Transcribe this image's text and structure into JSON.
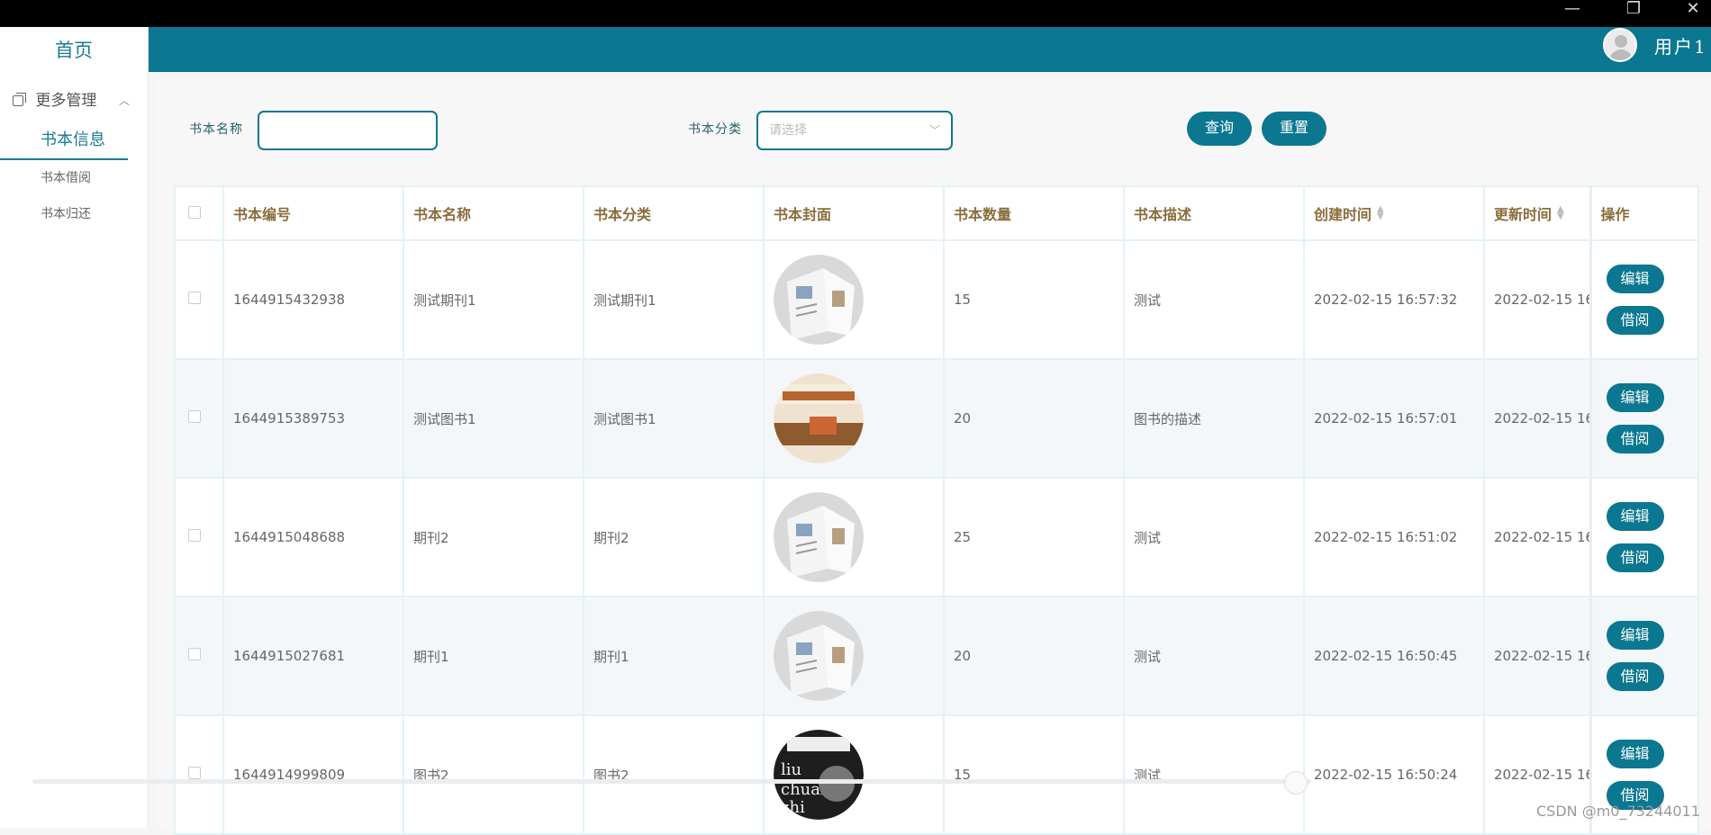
{
  "window": {
    "minimize_glyph": "—",
    "maximize_glyph": "❐",
    "close_glyph": "✕"
  },
  "sidebar": {
    "home": "首页",
    "group_label": "更多管理",
    "group_icon": "copy-icon",
    "items": [
      {
        "label": "书本信息",
        "active": true
      },
      {
        "label": "书本借阅",
        "active": false
      },
      {
        "label": "书本归还",
        "active": false
      }
    ]
  },
  "header": {
    "username": "用户1",
    "avatar_icon": "user-avatar-icon"
  },
  "search": {
    "name_label": "书本名称",
    "name_value": "",
    "category_label": "书本分类",
    "category_placeholder": "请选择",
    "query_button": "查询",
    "reset_button": "重置"
  },
  "table": {
    "columns": [
      "书本编号",
      "书本名称",
      "书本分类",
      "书本封面",
      "书本数量",
      "书本描述",
      "创建时间",
      "更新时间",
      "操作"
    ],
    "sortable_columns": [
      "创建时间",
      "更新时间"
    ],
    "rows": [
      {
        "id": "1644915432938",
        "name": "测试期刊1",
        "category": "测试期刊1",
        "cover": "magazine-cover",
        "quantity": "15",
        "desc": "测试",
        "created": "2022-02-15 16:57:32",
        "updated": "2022-02-15 16"
      },
      {
        "id": "1644915389753",
        "name": "测试图书1",
        "category": "测试图书1",
        "cover": "book-cover",
        "quantity": "20",
        "desc": "图书的描述",
        "created": "2022-02-15 16:57:01",
        "updated": "2022-02-15 16"
      },
      {
        "id": "1644915048688",
        "name": "期刊2",
        "category": "期刊2",
        "cover": "magazine-cover",
        "quantity": "25",
        "desc": "测试",
        "created": "2022-02-15 16:51:02",
        "updated": "2022-02-15 16"
      },
      {
        "id": "1644915027681",
        "name": "期刊1",
        "category": "期刊1",
        "cover": "magazine-cover",
        "quantity": "20",
        "desc": "测试",
        "created": "2022-02-15 16:50:45",
        "updated": "2022-02-15 16"
      },
      {
        "id": "1644914999809",
        "name": "图书2",
        "category": "图书2",
        "cover": "book-cover",
        "quantity": "15",
        "desc": "测试",
        "created": "2022-02-15 16:50:24",
        "updated": "2022-02-15 16"
      }
    ],
    "edit_label": "编辑",
    "borrow_label": "借阅"
  },
  "watermark": "CSDN @m0_73244011",
  "colors": {
    "primary": "#0b7790",
    "header_text": "#8a6d3b"
  }
}
